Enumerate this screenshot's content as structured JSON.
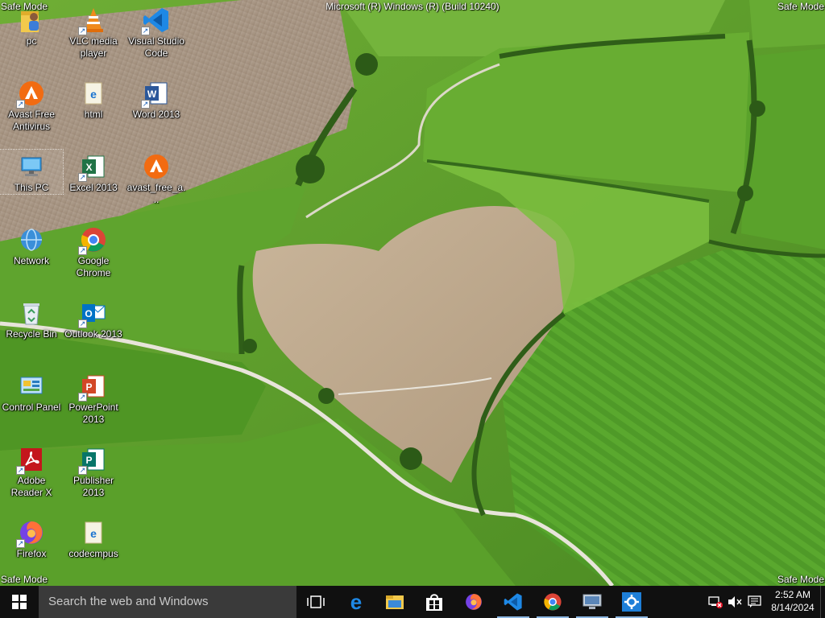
{
  "system": {
    "safe_mode": "Safe Mode",
    "build": "Microsoft (R) Windows (R) (Build 10240)"
  },
  "desktop": {
    "icons": [
      {
        "label": "pc",
        "icon": "user-folder-icon"
      },
      {
        "label": "VLC media player",
        "icon": "vlc-icon"
      },
      {
        "label": "Visual Studio Code",
        "icon": "vscode-icon"
      },
      {
        "label": "Avast Free Antivirus",
        "icon": "avast-icon"
      },
      {
        "label": "html",
        "icon": "edge-html-file-icon"
      },
      {
        "label": "Word 2013",
        "icon": "word-icon"
      },
      {
        "label": "This PC",
        "icon": "computer-icon"
      },
      {
        "label": "Excel 2013",
        "icon": "excel-icon"
      },
      {
        "label": "avast_free_a...",
        "icon": "avast-icon"
      },
      {
        "label": "Network",
        "icon": "network-icon"
      },
      {
        "label": "Google Chrome",
        "icon": "chrome-icon"
      },
      {
        "label": "Recycle Bin",
        "icon": "recycle-bin-icon"
      },
      {
        "label": "Outlook 2013",
        "icon": "outlook-icon"
      },
      {
        "label": "Control Panel",
        "icon": "control-panel-icon"
      },
      {
        "label": "PowerPoint 2013",
        "icon": "powerpoint-icon"
      },
      {
        "label": "Adobe Reader X",
        "icon": "adobe-reader-icon"
      },
      {
        "label": "Publisher 2013",
        "icon": "publisher-icon"
      },
      {
        "label": "Firefox",
        "icon": "firefox-icon"
      },
      {
        "label": "codecmpus",
        "icon": "file-icon"
      }
    ]
  },
  "taskbar": {
    "search_placeholder": "Search the web and Windows",
    "items": [
      "task-view-icon",
      "edge-icon",
      "file-explorer-icon",
      "store-icon",
      "firefox-icon",
      "vscode-icon",
      "chrome-icon",
      "remote-desktop-icon",
      "settings-icon"
    ],
    "tray": [
      "network-disconnected-icon",
      "volume-muted-icon",
      "action-center-icon"
    ],
    "time": "2:52 AM",
    "date": "8/14/2024"
  }
}
